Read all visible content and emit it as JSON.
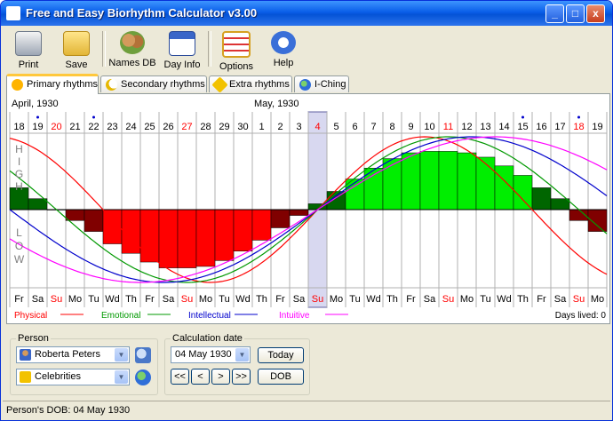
{
  "window": {
    "title": "Free and Easy Biorhythm Calculator v3.00",
    "minimize": "_",
    "maximize": "□",
    "close": "x"
  },
  "toolbar": {
    "print": "Print",
    "save": "Save",
    "names_db": "Names DB",
    "day_info": "Day Info",
    "options": "Options",
    "help": "Help"
  },
  "tabs": [
    "Primary rhythms",
    "Secondary rhythms",
    "Extra rhythms",
    "I-Ching"
  ],
  "chart": {
    "month_left": "April, 1930",
    "month_right": "May, 1930",
    "high_label": "HIGH",
    "low_label": "LOW",
    "dates": [
      "18",
      "19",
      "20",
      "21",
      "22",
      "23",
      "24",
      "25",
      "26",
      "27",
      "28",
      "29",
      "30",
      "1",
      "2",
      "3",
      "4",
      "5",
      "6",
      "7",
      "8",
      "9",
      "10",
      "11",
      "12",
      "13",
      "14",
      "15",
      "16",
      "17",
      "18",
      "19"
    ],
    "weekdays": [
      "Fr",
      "Sa",
      "Su",
      "Mo",
      "Tu",
      "Wd",
      "Th",
      "Fr",
      "Sa",
      "Su",
      "Mo",
      "Tu",
      "Wd",
      "Th",
      "Fr",
      "Sa",
      "Su",
      "Mo",
      "Tu",
      "Wd",
      "Th",
      "Fr",
      "Sa",
      "Su",
      "Mo",
      "Tu",
      "Wd",
      "Th",
      "Fr",
      "Sa",
      "Su",
      "Mo"
    ],
    "red_date_indices": [
      2,
      9,
      16,
      23,
      30
    ],
    "dot_date_indices": [
      1,
      4,
      27,
      30
    ],
    "selected_index": 16,
    "colors": {
      "physical": "#ff0000",
      "emotional": "#009900",
      "intellectual": "#0000cc",
      "intuitive": "#ff00ff",
      "bar_positive": "#00ee00",
      "bar_negative": "#ff0000",
      "bar_dark_positive": "#006600",
      "bar_dark_negative": "#800000"
    },
    "legend": [
      {
        "name": "Physical",
        "color": "#ff0000"
      },
      {
        "name": "Emotional",
        "color": "#009900"
      },
      {
        "name": "Intellectual",
        "color": "#0000cc"
      },
      {
        "name": "Intuitive",
        "color": "#ff00ff"
      }
    ],
    "days_lived": "Days lived: 0"
  },
  "chart_data": {
    "type": "line",
    "x": [
      "18",
      "19",
      "20",
      "21",
      "22",
      "23",
      "24",
      "25",
      "26",
      "27",
      "28",
      "29",
      "30",
      "1",
      "2",
      "3",
      "4",
      "5",
      "6",
      "7",
      "8",
      "9",
      "10",
      "11",
      "12",
      "13",
      "14",
      "15",
      "16",
      "17",
      "18",
      "19"
    ],
    "ylim": [
      -1,
      1
    ],
    "series": [
      {
        "name": "Physical",
        "period_days": 23,
        "phase_zero_index": 16
      },
      {
        "name": "Emotional",
        "period_days": 28,
        "phase_zero_index": 16
      },
      {
        "name": "Intellectual",
        "period_days": 33,
        "phase_zero_index": 16
      },
      {
        "name": "Intuitive",
        "period_days": 38,
        "phase_zero_index": 16
      }
    ],
    "bars": [
      0.3,
      0.15,
      0.0,
      -0.15,
      -0.3,
      -0.47,
      -0.6,
      -0.72,
      -0.8,
      -0.8,
      -0.78,
      -0.7,
      -0.57,
      -0.42,
      -0.25,
      -0.08,
      0.08,
      0.25,
      0.42,
      0.57,
      0.7,
      0.78,
      0.8,
      0.8,
      0.78,
      0.72,
      0.6,
      0.47,
      0.3,
      0.15,
      -0.15,
      -0.3
    ]
  },
  "person": {
    "group_label": "Person",
    "name": "Roberta Peters",
    "category": "Celebrities"
  },
  "calc": {
    "group_label": "Calculation date",
    "date": "04 May 1930",
    "today": "Today",
    "dob": "DOB",
    "nav": [
      "<<",
      "<",
      ">",
      ">>"
    ]
  },
  "status": {
    "text": "Person's DOB: 04 May 1930"
  }
}
